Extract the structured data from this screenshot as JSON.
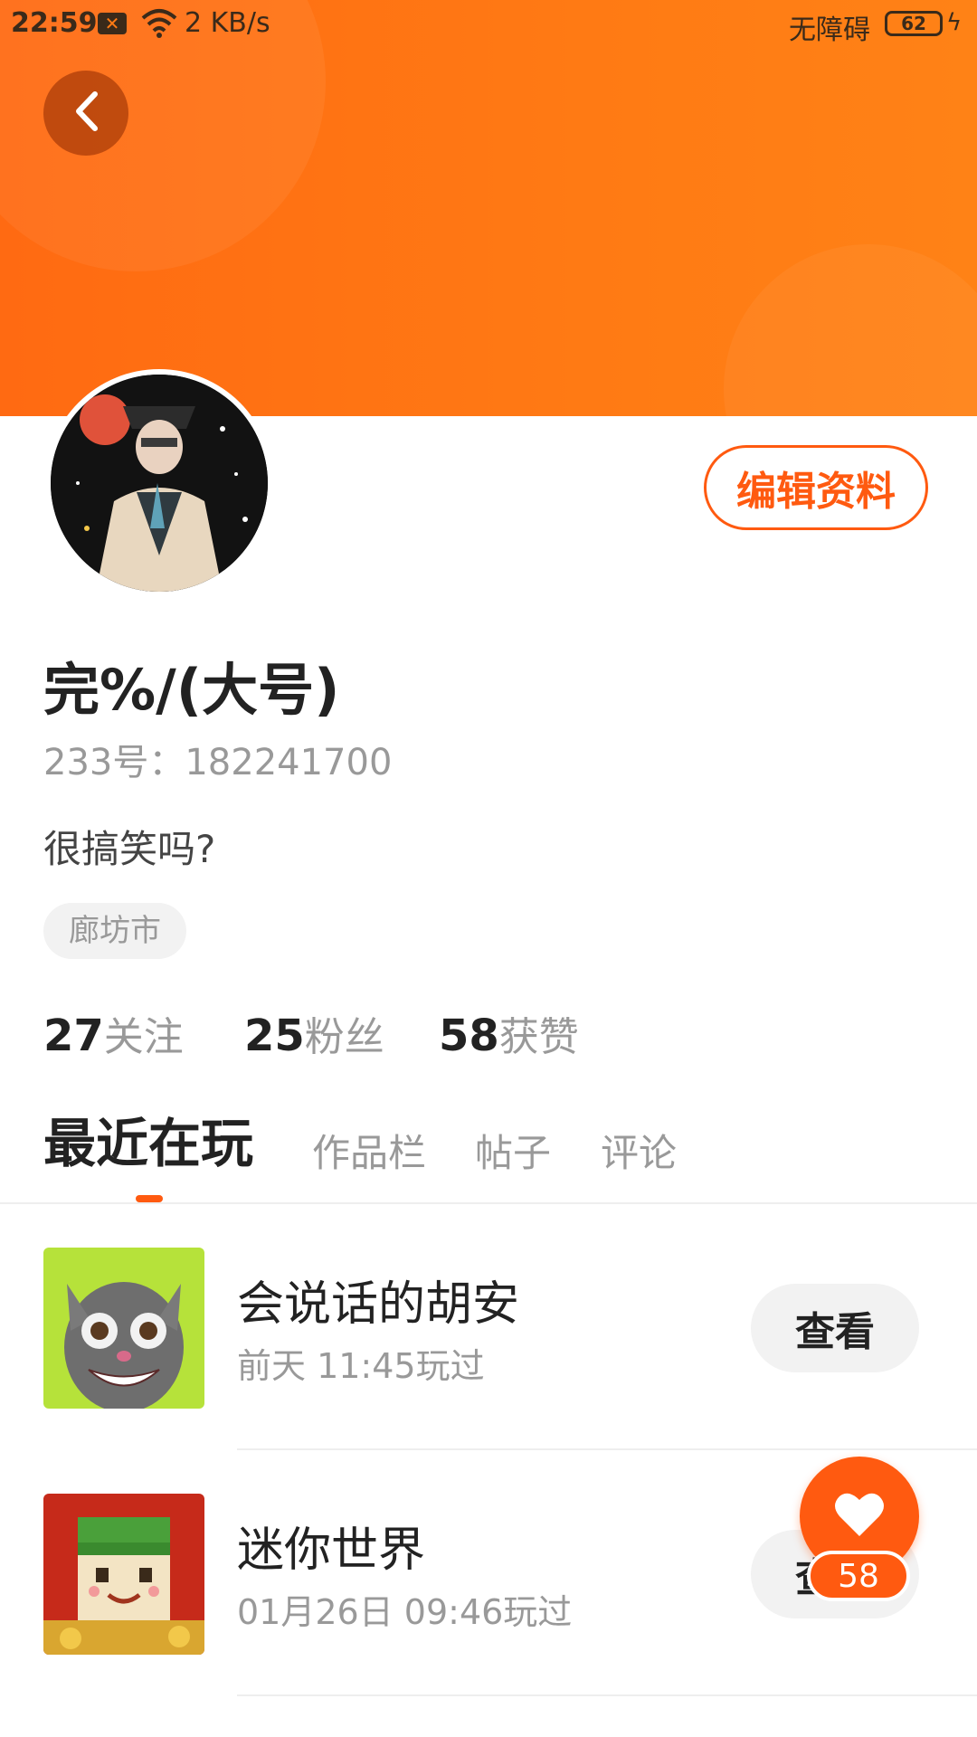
{
  "status_bar": {
    "time": "22:59",
    "sim_icon": "sim-error-icon",
    "wifi_icon": "wifi-icon",
    "net_speed": "2 KB/s",
    "accessibility": "无障碍",
    "battery": "62",
    "charging_icon": "bolt-icon"
  },
  "header": {
    "back_icon": "chevron-left-icon",
    "edit_profile_label": "编辑资料"
  },
  "profile": {
    "nickname": "完%/(大号)",
    "uid": "233号：182241700",
    "bio": "很搞笑吗?",
    "location": "廊坊市"
  },
  "stats": [
    {
      "value": "27",
      "label": "关注"
    },
    {
      "value": "25",
      "label": "粉丝"
    },
    {
      "value": "58",
      "label": "获赞"
    }
  ],
  "tabs": [
    {
      "label": "最近在玩",
      "active": true
    },
    {
      "label": "作品栏",
      "active": false
    },
    {
      "label": "帖子",
      "active": false
    },
    {
      "label": "评论",
      "active": false
    }
  ],
  "games": [
    {
      "name": "会说话的胡安",
      "last_played": "前天 11:45玩过",
      "button": "查看",
      "icon": "talking-juan-game-icon"
    },
    {
      "name": "迷你世界",
      "last_played": "01月26日 09:46玩过",
      "button": "查看",
      "icon": "mini-world-game-icon"
    }
  ],
  "like_fab": {
    "icon": "heart-icon",
    "count": "58"
  },
  "colors": {
    "brand_orange": "#ff5a10",
    "header_gradient_start": "#ff6a12",
    "header_gradient_end": "#ff8216"
  }
}
